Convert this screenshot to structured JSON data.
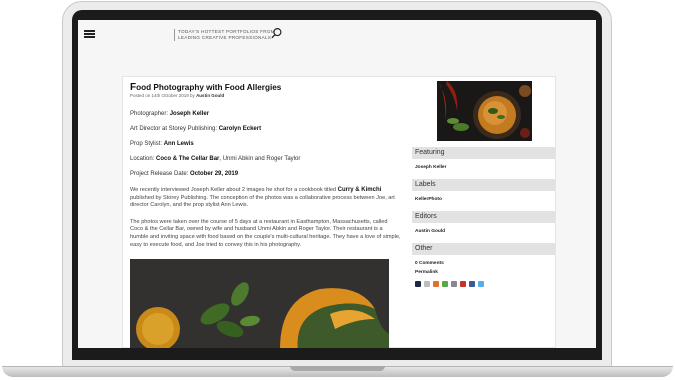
{
  "header": {
    "logo_line1": "TODAY'S HOTTEST PORTFOLIOS FROM",
    "logo_line2": "LEADING CREATIVE PROFESSIONALS",
    "menu_icon": "hamburger-menu-icon",
    "search_icon": "search-icon"
  },
  "post": {
    "title_first": "F",
    "title_rest": "ood Photography with Food Allergies",
    "meta_prefix": "Posted on 14th October 2019 by",
    "meta_author": "Austin Gould",
    "photographer_label": "Photographer:",
    "photographer": "Joseph Keller",
    "art_director_label": "Art Director at Storey Publishing:",
    "art_director": "Carolyn Eckert",
    "prop_stylist_label": "Prop Stylist:",
    "prop_stylist": "Ann Lewis",
    "location_label": "Location:",
    "location_bold": "Coco & The Cellar Bar",
    "location_rest": ", Unmi Abkin and Roger Taylor",
    "release_label": "Project Release Date:",
    "release_date": "October 29, 2019",
    "para1_a": "We recently interviewed Joseph Keller about 2 images he shot for a cookbook titled ",
    "para1_book": "Curry & Kimchi",
    "para1_b": " published by Storey Publishing. The conception of the photos was a collaborative process between Joe, art director Carolyn, and the prop stylist Ann Lewis.",
    "para2": "The photos were taken over the course of 5 days at a restaurant in Easthampton, Massachusetts, called Coco & the Cellar Bar, owned by wife and husband Unmi Abkin and Roger Taylor.  Their restaurant is a humble and inviting space with food based on the couple's multi-cultural heritage. They have a love of simple, easy to execute food, and Joe tried to convey this in his photography."
  },
  "sidebar": {
    "featuring_title": "Featuring",
    "featuring_item": "Joseph Keller",
    "labels_title": "Labels",
    "labels_item": "KellerPhoto",
    "editors_title": "Editors",
    "editors_item": "Austin Gould",
    "other_title": "Other",
    "comments": "0 Comments",
    "permalink": "Permalink"
  },
  "colors": {
    "sidebar_header_bg": "#e2e2e2",
    "share_icons": [
      "#3b5998",
      "#1da1f2",
      "#e0712c",
      "#5aa64b",
      "#888888",
      "#c9302c",
      "#2b6cb0",
      "#55acee"
    ]
  }
}
